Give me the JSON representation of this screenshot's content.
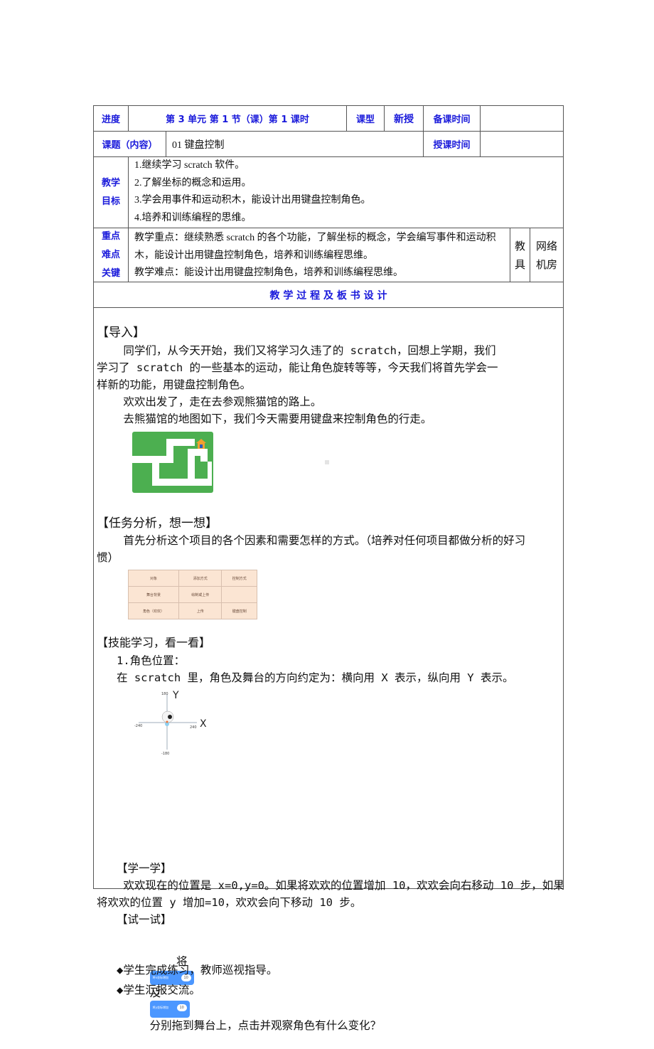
{
  "header": {
    "progress_label": "进度",
    "progress_value": "第 3 单元 第 1 节（课）第 1 课时",
    "type_label": "课型",
    "type_value": "新授",
    "prep_time_label": "备课时间",
    "prep_time_value": "",
    "topic_label": "课题（内容）",
    "topic_value": "01  键盘控制",
    "teach_time_label": "授课时间",
    "teach_time_value": ""
  },
  "goals": {
    "label_line1": "教学",
    "label_line2": "目标",
    "items": [
      "1.继续学习 scratch 软件。",
      "2.了解坐标的概念和运用。",
      "3.学会用事件和运动积木，能设计出用键盘控制角色。",
      "4.培养和训练编程的思维。"
    ]
  },
  "keypoints": {
    "label_line1": "重点",
    "label_line2": "难点",
    "label_line3": "关键",
    "focus": "教学重点：继续熟悉 scratch 的各个功能，了解坐标的概念，学会编写事件和运动积木，能设计出用键盘控制角色，培养和训练编程思维。",
    "difficulty": "教学难点：能设计出用键盘控制角色，培养和训练编程思维。",
    "tools_label_line1": "教",
    "tools_label_line2": "具",
    "tools_value_line1": "网络",
    "tools_value_line2": "机房"
  },
  "process_title": "教 学 过 程 及 板 书 设 计",
  "intro": {
    "heading": "【导入】",
    "p1_line1": "    同学们，从今天开始，我们又将学习久违了的 scratch，回想上学期，我们",
    "p1_line2": "学习了 scratch 的一些基本的运动，能让角色旋转等等，今天我们将首先学会一",
    "p1_line3": "样新的功能，用键盘控制角色。",
    "p2": "    欢欢出发了，走在去参观熊猫馆的路上。",
    "p3": "    去熊猫馆的地图如下，我们今天需要用键盘来控制角色的行走。",
    "map_image_alt": "熊猫馆迷宫地图"
  },
  "analysis": {
    "heading": "【任务分析，想一想】",
    "p1_line1": "    首先分析这个项目的各个因素和需要怎样的方式。（培养对任何项目都做分析的好习",
    "p1_line2": "惯）",
    "table": {
      "headers": [
        "对象",
        "添加方式",
        "控制方式"
      ],
      "rows": [
        [
          "舞台背景",
          "绘制或上传",
          ""
        ],
        [
          "角色（欢欢）",
          "上传",
          "键盘控制"
        ]
      ]
    }
  },
  "skills": {
    "heading": "【技能学习，看一看】",
    "item1": "   1.角色位置：",
    "p1": "   在 scratch 里，角色及舞台的方向约定为：横向用 X 表示，纵向用 Y 表示。",
    "axes": {
      "x_label": "X",
      "y_label": "Y",
      "x_min": "-240",
      "x_max": "240",
      "y_max": "180",
      "y_min": "-180"
    }
  },
  "learn": {
    "heading": "   【学一学】",
    "p1_line1": "    欢欢现在的位置是 x=0,y=0。如果将欢欢的位置增加 10，欢欢会向右移动 10 步，如果",
    "p1_line2": "将欢欢的位置 y 增加=10，欢欢会向下移动 10 步。"
  },
  "try": {
    "heading": "   【试一试】",
    "prefix": "    将",
    "middle": "及",
    "suffix": "分别拖到舞台上，点击并观察角色有什么变化？",
    "block1_label": "将x坐标增加",
    "block1_value": "10",
    "block2_label": "将y坐标增加",
    "block2_value": "10",
    "bullet1": "   ◆学生完成练习，教师巡视指导。",
    "bullet2": "   ◆学生汇报交流。"
  },
  "colors": {
    "label_blue": "#1a1adb",
    "border": "#555555",
    "maze_green": "#4caf50",
    "scratch_blue": "#4c97ff"
  }
}
